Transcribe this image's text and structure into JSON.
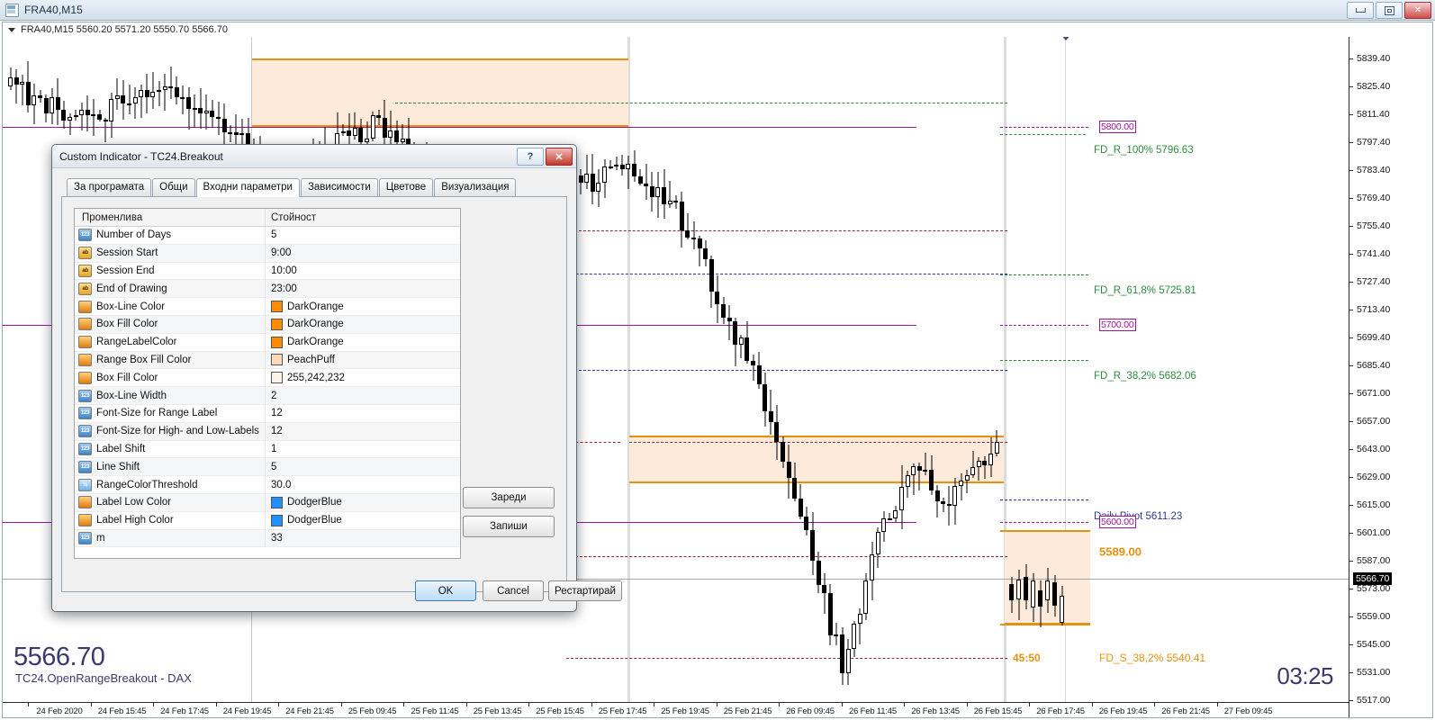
{
  "window": {
    "title": "FRA40,M15",
    "icon": "chart-window-icon",
    "buttons": {
      "minimize": "minimize-icon",
      "maximize": "maximize-icon",
      "close": "close-icon"
    }
  },
  "chart": {
    "quote_line": "FRA40,M15  5560.20 5571.20 5550.70 5566.70",
    "symbol": "FRA40",
    "timeframe": "M15",
    "ohlc": {
      "open": "5560.20",
      "high": "5571.20",
      "low": "5550.70",
      "close": "5566.70"
    },
    "big_price": "5566.70",
    "indicator_caption": "TC24.OpenRangeBreakout - DAX",
    "clock": "03:25",
    "current_price_tag": "5566.70",
    "price_axis": {
      "labels": [
        "5839.40",
        "5825.40",
        "5811.40",
        "5797.40",
        "5783.40",
        "5769.40",
        "5755.40",
        "5741.40",
        "5727.40",
        "5713.40",
        "5699.40",
        "5685.40",
        "5671.00",
        "5657.00",
        "5643.00",
        "5629.00",
        "5615.00",
        "5601.00",
        "5587.00",
        "5573.00",
        "5559.00",
        "5545.00",
        "5531.00",
        "5517.00"
      ]
    },
    "time_axis": {
      "labels": [
        "24 Feb 2020",
        "24 Feb 15:45",
        "24 Feb 17:45",
        "24 Feb 19:45",
        "24 Feb 21:45",
        "25 Feb 09:45",
        "25 Feb 11:45",
        "25 Feb 13:45",
        "25 Feb 15:45",
        "25 Feb 17:45",
        "25 Feb 19:45",
        "25 Feb 21:45",
        "26 Feb 09:45",
        "26 Feb 11:45",
        "26 Feb 13:45",
        "26 Feb 15:45",
        "26 Feb 17:45",
        "26 Feb 19:45",
        "26 Feb 21:45",
        "27 Feb 09:45"
      ]
    },
    "annotations": [
      {
        "name": "fib-100",
        "text": "FD_R_100% 5796.63",
        "color": "#2e8b3c"
      },
      {
        "name": "fib-618",
        "text": "FD_R_61,8% 5725.81",
        "color": "#2e8b3c"
      },
      {
        "name": "fib-382",
        "text": "FD_R_38,2% 5682.06",
        "color": "#2e8b3c"
      },
      {
        "name": "daily-pivot",
        "text": "Daily Pivot 5611.23",
        "color": "#2b3a8c"
      },
      {
        "name": "range-high-label",
        "text": "5589.00",
        "color": "#e8910d"
      },
      {
        "name": "range-time-label",
        "text": "45:50",
        "color": "#e8910d"
      },
      {
        "name": "fib-overlap-label",
        "text": "FD_S_38,2% 5540.41",
        "color": "#e8910d"
      }
    ],
    "price_tags": [
      {
        "name": "level-5800",
        "text": "5800.00",
        "color": "#a0159b"
      },
      {
        "name": "level-5700",
        "text": "5700.00",
        "color": "#a0159b"
      },
      {
        "name": "level-5600",
        "text": "5600.00",
        "color": "#a0159b"
      }
    ]
  },
  "dialog": {
    "title": "Custom Indicator - TC24.Breakout",
    "help_button": "?",
    "close_button": "✕",
    "tabs": [
      {
        "label": "За програмата",
        "active": false
      },
      {
        "label": "Общи",
        "active": false
      },
      {
        "label": "Входни параметри",
        "active": true
      },
      {
        "label": "Зависимости",
        "active": false
      },
      {
        "label": "Цветове",
        "active": false
      },
      {
        "label": "Визуализация",
        "active": false
      }
    ],
    "grid": {
      "headers": {
        "variable": "Променлива",
        "value": "Стойност"
      },
      "rows": [
        {
          "icon": "int-type-icon",
          "icon_kind": "num",
          "name": "Number of Days",
          "value": "5"
        },
        {
          "icon": "string-type-icon",
          "icon_kind": "str",
          "name": "Session Start",
          "value": "9:00"
        },
        {
          "icon": "string-type-icon",
          "icon_kind": "str",
          "name": "Session End",
          "value": "10:00"
        },
        {
          "icon": "string-type-icon",
          "icon_kind": "str",
          "name": "End of Drawing",
          "value": "23:00"
        },
        {
          "icon": "color-type-icon",
          "icon_kind": "col",
          "name": "Box-Line Color",
          "value": "DarkOrange",
          "swatch": "#ff8c00"
        },
        {
          "icon": "color-type-icon",
          "icon_kind": "col",
          "name": "Box Fill Color",
          "value": "DarkOrange",
          "swatch": "#ff8c00"
        },
        {
          "icon": "color-type-icon",
          "icon_kind": "col",
          "name": "RangeLabelColor",
          "value": "DarkOrange",
          "swatch": "#ff8c00"
        },
        {
          "icon": "color-type-icon",
          "icon_kind": "col",
          "name": "Range Box Fill Color",
          "value": "PeachPuff",
          "swatch": "#ffdab9"
        },
        {
          "icon": "color-type-icon",
          "icon_kind": "col",
          "name": "Box Fill Color",
          "value": "255,242,232",
          "swatch": "#fff2e8"
        },
        {
          "icon": "int-type-icon",
          "icon_kind": "num",
          "name": "Box-Line Width",
          "value": "2"
        },
        {
          "icon": "int-type-icon",
          "icon_kind": "num",
          "name": "Font-Size for Range Label",
          "value": "12"
        },
        {
          "icon": "int-type-icon",
          "icon_kind": "num",
          "name": "Font-Size for High- and Low-Labels",
          "value": "12"
        },
        {
          "icon": "int-type-icon",
          "icon_kind": "num",
          "name": "Label Shift",
          "value": "1"
        },
        {
          "icon": "int-type-icon",
          "icon_kind": "num",
          "name": "Line Shift",
          "value": "5"
        },
        {
          "icon": "double-type-icon",
          "icon_kind": "dbl",
          "name": "RangeColorThreshold",
          "value": "30.0"
        },
        {
          "icon": "color-type-icon",
          "icon_kind": "col",
          "name": "Label Low Color",
          "value": "DodgerBlue",
          "swatch": "#1e90ff"
        },
        {
          "icon": "color-type-icon",
          "icon_kind": "col",
          "name": "Label High Color",
          "value": "DodgerBlue",
          "swatch": "#1e90ff"
        },
        {
          "icon": "int-type-icon",
          "icon_kind": "num",
          "name": "m",
          "value": "33"
        }
      ]
    },
    "side_buttons": {
      "load": "Зареди",
      "save": "Запиши"
    },
    "footer_buttons": {
      "ok": "OK",
      "cancel": "Cancel",
      "restart": "Рестартирай"
    }
  },
  "colors": {
    "box_line": "#e8910d",
    "box_fill": "#fdeadb",
    "magenta_level": "#a0159b",
    "fib_green": "#2e8b3c",
    "pivot_blue": "#2b3a8c",
    "dark_red_dash": "#8b2b3a"
  }
}
